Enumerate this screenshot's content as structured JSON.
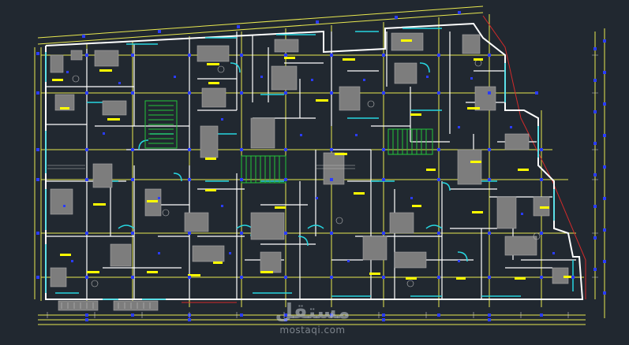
{
  "viewport": {
    "background": "#212830"
  },
  "palette": {
    "wall": "#ffffff",
    "axis": "#e8e850",
    "glazing": "#27d6e0",
    "column": "#2a3cff",
    "tag": "#ffff00",
    "stair": "#22c63a",
    "furniture": "#8a8a8a",
    "boundary": "#d22a2a",
    "dimension": "#c9c9c9"
  },
  "watermark": {
    "logo_text": "مستقل",
    "caption": "mostaqi.com"
  }
}
